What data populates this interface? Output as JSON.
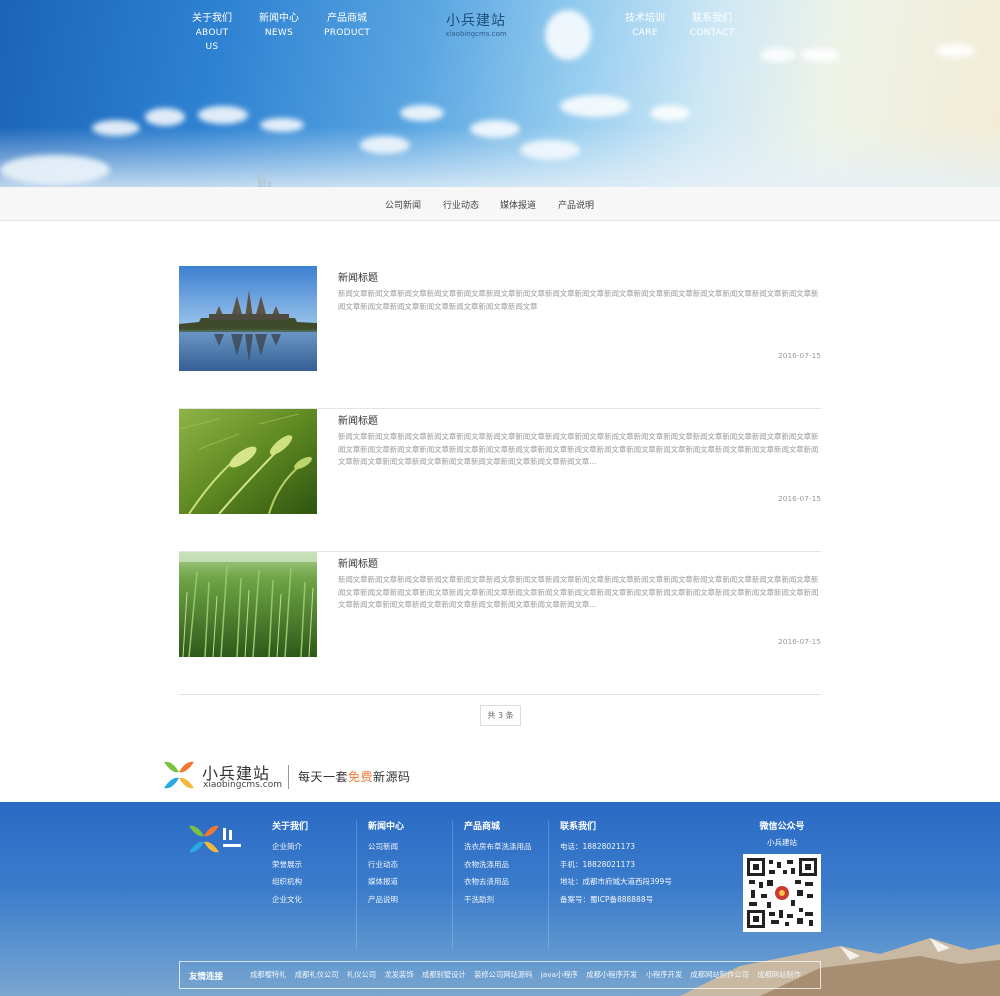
{
  "hero": {
    "nav_left": [
      {
        "cn": "关于我们",
        "en": "ABOUT US"
      },
      {
        "cn": "新闻中心",
        "en": "NEWS"
      },
      {
        "cn": "产品商城",
        "en": "PRODUCT"
      }
    ],
    "nav_right": [
      {
        "cn": "技术培训",
        "en": "CARE"
      },
      {
        "cn": "联系我们",
        "en": "CONTACT"
      }
    ],
    "logo_text": "小兵建站",
    "logo_url": "xiaobingcms.com"
  },
  "subnav": [
    "公司新闻",
    "行业动态",
    "媒体报道",
    "产品说明"
  ],
  "news": [
    {
      "title": "新闻标题",
      "body": "新闻文章新闻文章新闻文章新闻文章新闻文章新闻文章新闻文章新闻文章新闻文章新闻文章新闻文章新闻文章新闻文章新闻文章新闻文章新闻文章新闻文章新闻文章新闻文章新闻文章新闻文章新闻文章新闻文章",
      "date": "2016-07-15"
    },
    {
      "title": "新闻标题",
      "body": "新闻文章新闻文章新闻文章新闻文章新闻文章新闻文章新闻文章新闻文章新闻文章新闻文章新闻文章新闻文章新闻文章新闻文章新闻文章新闻文章新闻文章新闻文章新闻文章新闻文章新闻文章新闻文章新闻文章新闻文章新闻文章新闻文章新闻文章新闻文章新闻文章新闻文章新闻文章新闻文章新闻文章新闻文章新闻文章新闻文章新闻文章新闻文章新闻文章新闻文章新闻文章...",
      "date": "2016-07-15"
    },
    {
      "title": "新闻标题",
      "body": "新闻文章新闻文章新闻文章新闻文章新闻文章新闻文章新闻文章新闻文章新闻文章新闻文章新闻文章新闻文章新闻文章新闻文章新闻文章新闻文章新闻文章新闻文章新闻文章新闻文章新闻文章新闻文章新闻文章新闻文章新闻文章新闻文章新闻文章新闻文章新闻文章新闻文章新闻文章新闻文章新闻文章新闻文章新闻文章新闻文章新闻文章新闻文章新闻文章新闻文章新闻文章...",
      "date": "2016-07-15"
    }
  ],
  "pager": "共 3 条",
  "brand": {
    "name": "小兵建站",
    "url": "xiaobingcms.com",
    "slogan_pre": "每天一套",
    "slogan_hl": "免费",
    "slogan_post": "新源码"
  },
  "footer": {
    "columns": [
      {
        "title": "关于我们",
        "items": [
          "企业简介",
          "荣誉展示",
          "组织机构",
          "企业文化"
        ]
      },
      {
        "title": "新闻中心",
        "items": [
          "公司新闻",
          "行业动态",
          "媒体报道",
          "产品说明"
        ]
      },
      {
        "title": "产品商城",
        "items": [
          "洗衣房布草洗涤用品",
          "衣物洗涤用品",
          "衣物去渍用品",
          "干洗助剂"
        ]
      },
      {
        "title": "联系我们",
        "items": [
          "电话：18828021173",
          "手机：18828021173",
          "地址：成都市府城大道西段399号",
          "备案号：蜀ICP备888888号"
        ]
      }
    ],
    "wechat_title": "微信公众号",
    "wechat_sub": "小兵建站",
    "links_label": "友情连接",
    "links": [
      "成都樱特礼",
      "成都礼仪公司",
      "礼仪公司",
      "龙发装饰",
      "成都别墅设计",
      "装修公司网站源码",
      "java小程序",
      "成都小程序开发",
      "小程序开发",
      "成都网站制作公司",
      "成都网站制作"
    ]
  },
  "colors": {
    "accent_orange": "#f07833",
    "footer_blue": "#2a6ac5"
  }
}
